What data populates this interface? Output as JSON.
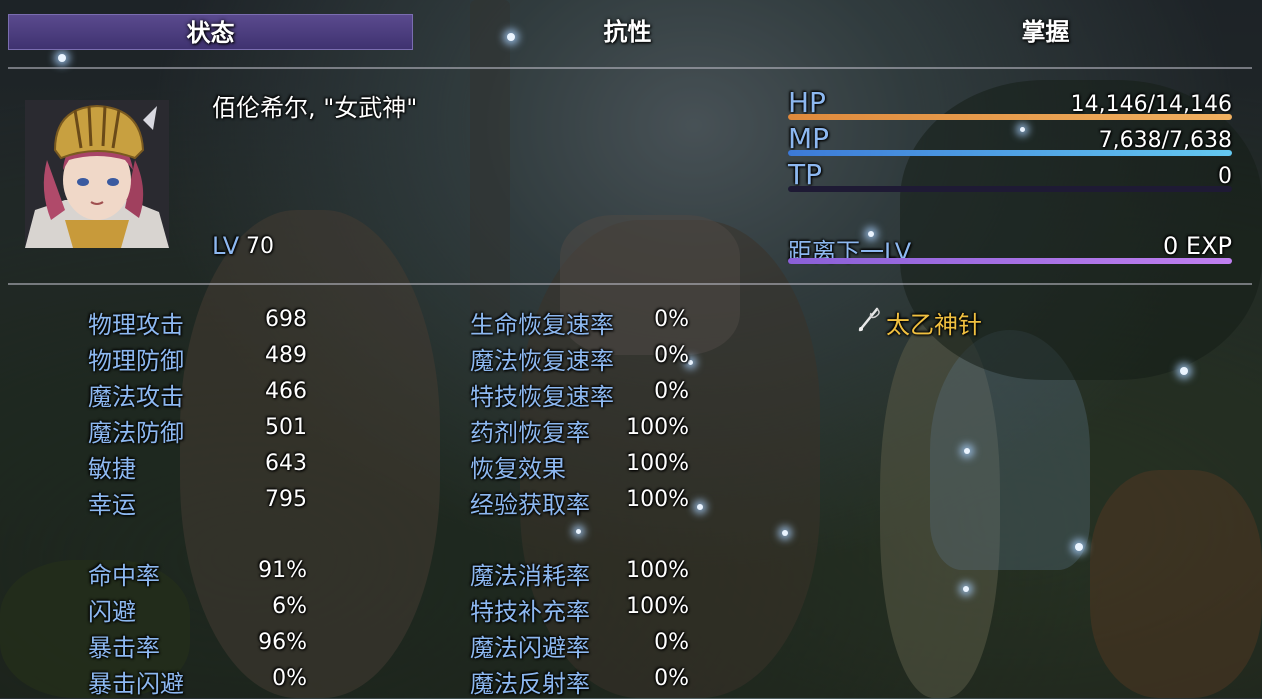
{
  "tabs": [
    {
      "label": "状态",
      "active": true
    },
    {
      "label": "抗性",
      "active": false
    },
    {
      "label": "掌握",
      "active": false
    }
  ],
  "actor": {
    "name": "佰伦希尔, \"女武神\"",
    "level_label": "LV",
    "level": "70"
  },
  "gauges": {
    "hp": {
      "label": "HP",
      "value": "14,146/14,146",
      "fraction": 1.0,
      "color_start": "#e08a3c",
      "color_end": "#f0b060"
    },
    "mp": {
      "label": "MP",
      "value": "7,638/7,638",
      "fraction": 1.0,
      "color_start": "#3c7ad8",
      "color_end": "#64c8f0"
    },
    "tp": {
      "label": "TP",
      "value": "0",
      "fraction": 0.0,
      "color_start": "#40a040",
      "color_end": "#80e080"
    },
    "exp": {
      "label": "距离下一LV",
      "value": "0 EXP",
      "fraction": 1.0,
      "color_start": "#8a60d8",
      "color_end": "#c080f0"
    }
  },
  "params": [
    {
      "label": "物理攻击",
      "value": "698"
    },
    {
      "label": "物理防御",
      "value": "489"
    },
    {
      "label": "魔法攻击",
      "value": "466"
    },
    {
      "label": "魔法防御",
      "value": "501"
    },
    {
      "label": "敏捷",
      "value": "643"
    },
    {
      "label": "幸运",
      "value": "795"
    }
  ],
  "xparams": [
    {
      "label": "命中率",
      "value": "91%"
    },
    {
      "label": "闪避",
      "value": "6%"
    },
    {
      "label": "暴击率",
      "value": "96%"
    },
    {
      "label": "暴击闪避",
      "value": "0%"
    }
  ],
  "regen": [
    {
      "label": "生命恢复速率",
      "value": "0%"
    },
    {
      "label": "魔法恢复速率",
      "value": "0%"
    },
    {
      "label": "特技恢复速率",
      "value": "0%"
    },
    {
      "label": "药剂恢复率",
      "value": "100%"
    },
    {
      "label": "恢复效果",
      "value": "100%"
    },
    {
      "label": "经验获取率",
      "value": "100%"
    }
  ],
  "sparams": [
    {
      "label": "魔法消耗率",
      "value": "100%"
    },
    {
      "label": "特技补充率",
      "value": "100%"
    },
    {
      "label": "魔法闪避率",
      "value": "0%"
    },
    {
      "label": "魔法反射率",
      "value": "0%"
    }
  ],
  "equipment": {
    "icon": "needle-icon",
    "name": "太乙神针",
    "color": "#f0c040"
  }
}
